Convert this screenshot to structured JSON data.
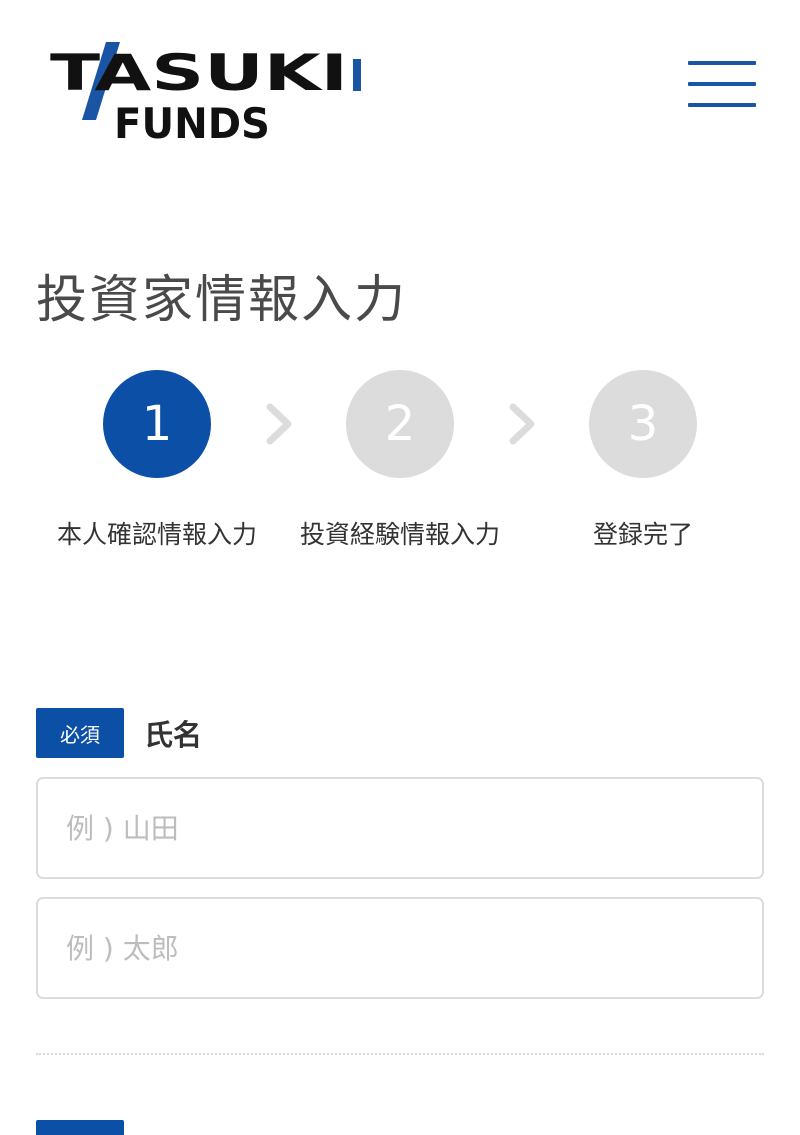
{
  "header": {
    "logo_text_top": "TASUKI",
    "logo_text_bottom": "FUNDS",
    "menu_icon": "hamburger-menu-icon"
  },
  "page": {
    "title": "投資家情報入力"
  },
  "stepper": {
    "steps": [
      {
        "number": "1",
        "label": "本人確認情報入力",
        "state": "active"
      },
      {
        "number": "2",
        "label": "投資経験情報入力",
        "state": "inactive"
      },
      {
        "number": "3",
        "label": "登録完了",
        "state": "inactive"
      }
    ],
    "separator_icon": "chevron-right-icon"
  },
  "form": {
    "name_field": {
      "required_badge": "必須",
      "label": "氏名",
      "last_name_placeholder": "例 ) 山田",
      "first_name_placeholder": "例 ) 太郎"
    },
    "next_field": {
      "required_badge": "",
      "label": ""
    }
  },
  "colors": {
    "primary": "#0b4fa6",
    "inactive_step": "#dcdcdc",
    "chevron": "#dcdcdc",
    "border": "#dcdcdc",
    "placeholder": "#bdbdbd"
  }
}
